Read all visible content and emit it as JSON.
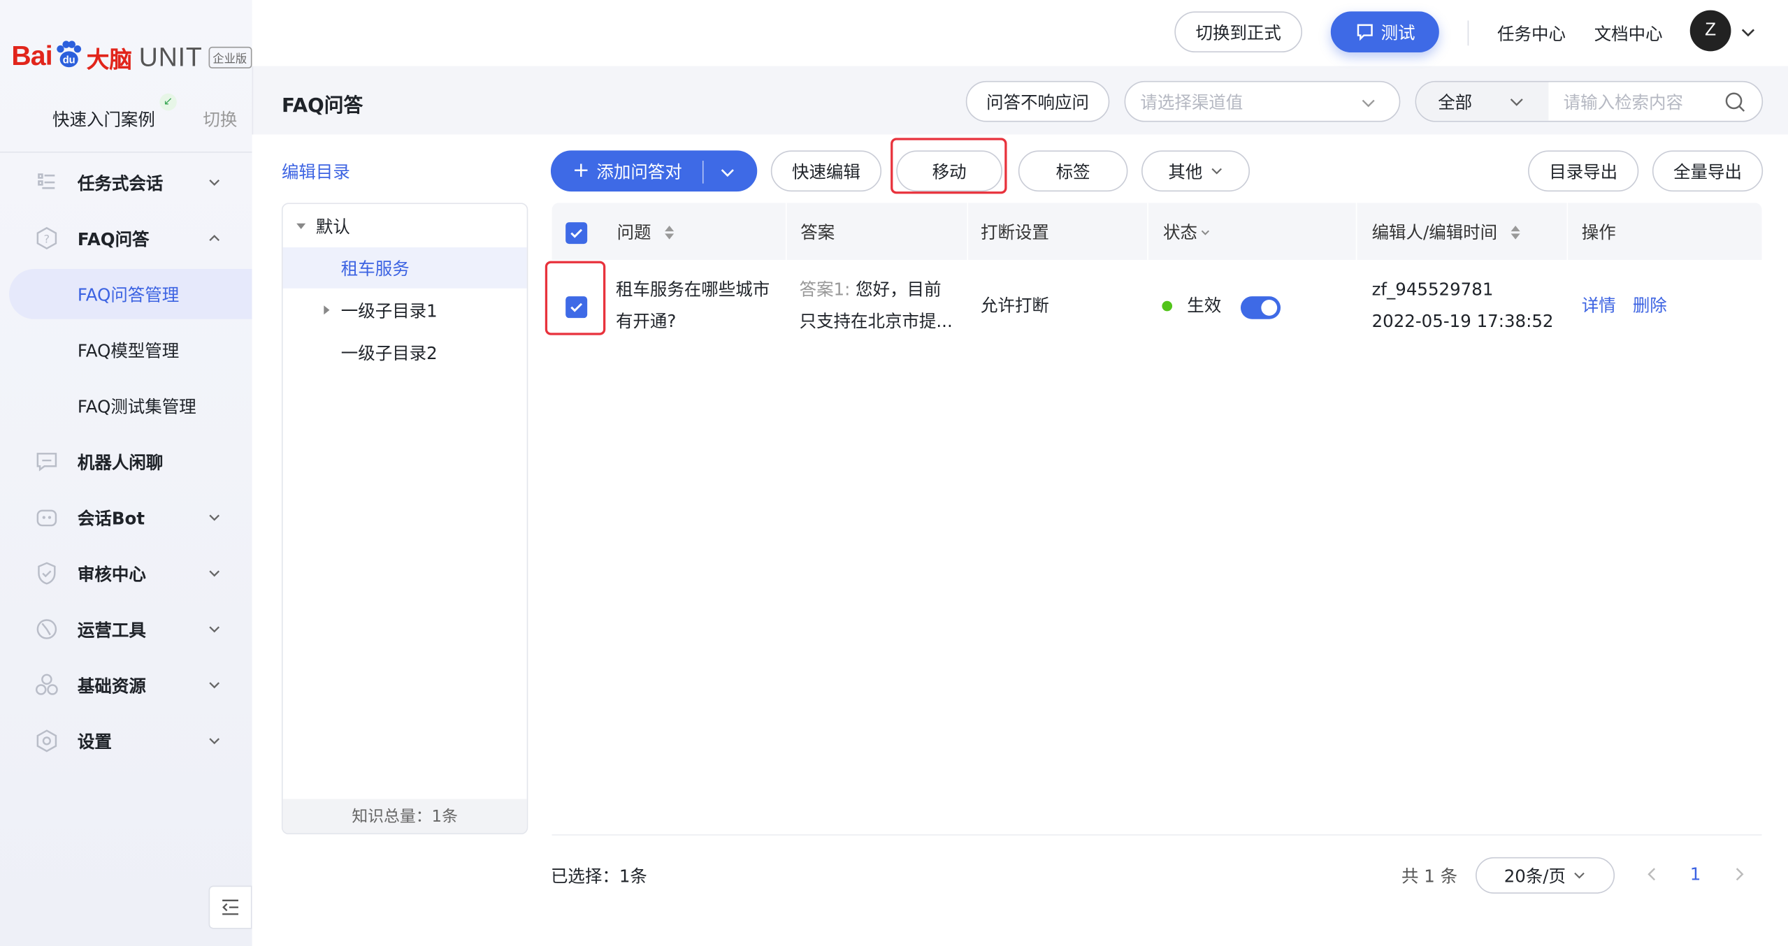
{
  "brand": {
    "bai": "Bai",
    "du": "du",
    "danao": "大脑",
    "unit": "UNIT",
    "edition": "企业版"
  },
  "sidebar": {
    "quick_start": "快速入门案例",
    "switch": "切换",
    "items": [
      {
        "label": "任务式会话",
        "icon": "task-icon"
      },
      {
        "label": "FAQ问答",
        "icon": "faq-icon"
      },
      {
        "label": "FAQ问答管理"
      },
      {
        "label": "FAQ模型管理"
      },
      {
        "label": "FAQ测试集管理"
      },
      {
        "label": "机器人闲聊",
        "icon": "chat-icon"
      },
      {
        "label": "会话Bot",
        "icon": "bot-icon"
      },
      {
        "label": "审核中心",
        "icon": "shield-icon"
      },
      {
        "label": "运营工具",
        "icon": "tools-icon"
      },
      {
        "label": "基础资源",
        "icon": "resources-icon"
      },
      {
        "label": "设置",
        "icon": "settings-icon"
      }
    ]
  },
  "topbar": {
    "switch_formal": "切换到正式",
    "test": "测试",
    "task_center": "任务中心",
    "doc_center": "文档中心",
    "avatar_letter": "Z"
  },
  "header": {
    "title": "FAQ问答",
    "no_response_btn": "问答不响应问",
    "channel_placeholder": "请选择渠道值",
    "scope": "全部",
    "search_placeholder": "请输入检索内容"
  },
  "tree": {
    "title": "编辑目录",
    "nodes": [
      "默认",
      "租车服务",
      "一级子目录1",
      "一级子目录2"
    ],
    "footer": "知识总量：1条"
  },
  "toolbar": {
    "add": "添加问答对",
    "quick_edit": "快速编辑",
    "move": "移动",
    "tag": "标签",
    "other": "其他",
    "export_dir": "目录导出",
    "export_all": "全量导出"
  },
  "table": {
    "headers": [
      "问题",
      "答案",
      "打断设置",
      "状态",
      "编辑人/编辑时间",
      "操作"
    ],
    "rows": [
      {
        "question_line1": "租车服务在哪些城市",
        "question_line2": "有开通?",
        "answer_prefix": "答案1:",
        "answer_line1": "您好，目前",
        "answer_line2": "只支持在北京市提...",
        "interrupt": "允许打断",
        "status": "生效",
        "editor": "zf_945529781",
        "time": "2022-05-19 17:38:52",
        "action_detail": "详情",
        "action_delete": "删除"
      }
    ]
  },
  "footer": {
    "selected": "已选择：1条",
    "total": "共 1 条",
    "page_size": "20条/页",
    "page": "1"
  },
  "colors": {
    "accent": "#3e6ae6",
    "highlight": "#e8323c",
    "active_status": "#52c41a"
  }
}
